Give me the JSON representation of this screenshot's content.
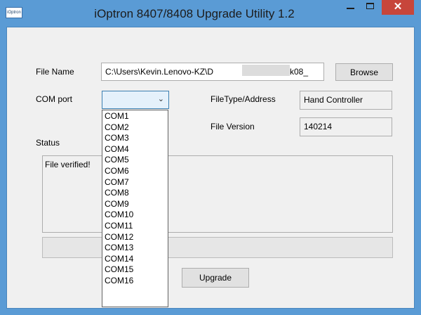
{
  "window": {
    "title": "iOptron 8407/8408 Upgrade Utility 1.2",
    "app_icon_text": "iOptron",
    "close_glyph": "✕"
  },
  "form": {
    "file_name_label": "File Name",
    "file_name_value": "C:\\Users\\Kevin.Lenovo-KZ\\D",
    "file_name_suffix": "sk08_",
    "browse_label": "Browse",
    "com_port_label": "COM port",
    "com_port_value": "",
    "file_type_label": "FileType/Address",
    "file_type_value": "Hand Controller",
    "file_version_label": "File Version",
    "file_version_value": "140214",
    "status_label": "Status",
    "status_text": "File verified!",
    "upgrade_label": "Upgrade"
  },
  "com_dropdown": {
    "options": [
      "COM1",
      "COM2",
      "COM3",
      "COM4",
      "COM5",
      "COM6",
      "COM7",
      "COM8",
      "COM9",
      "COM10",
      "COM11",
      "COM12",
      "COM13",
      "COM14",
      "COM15",
      "COM16"
    ]
  },
  "colors": {
    "titlebar": "#5a9bd5",
    "close_button": "#c7463b",
    "client_background": "#f0f0f0"
  },
  "icons": {
    "app": "app-icon",
    "minimize": "minimize-icon",
    "maximize": "maximize-icon",
    "close": "close-icon",
    "combo_arrow": "chevron-down-icon"
  }
}
